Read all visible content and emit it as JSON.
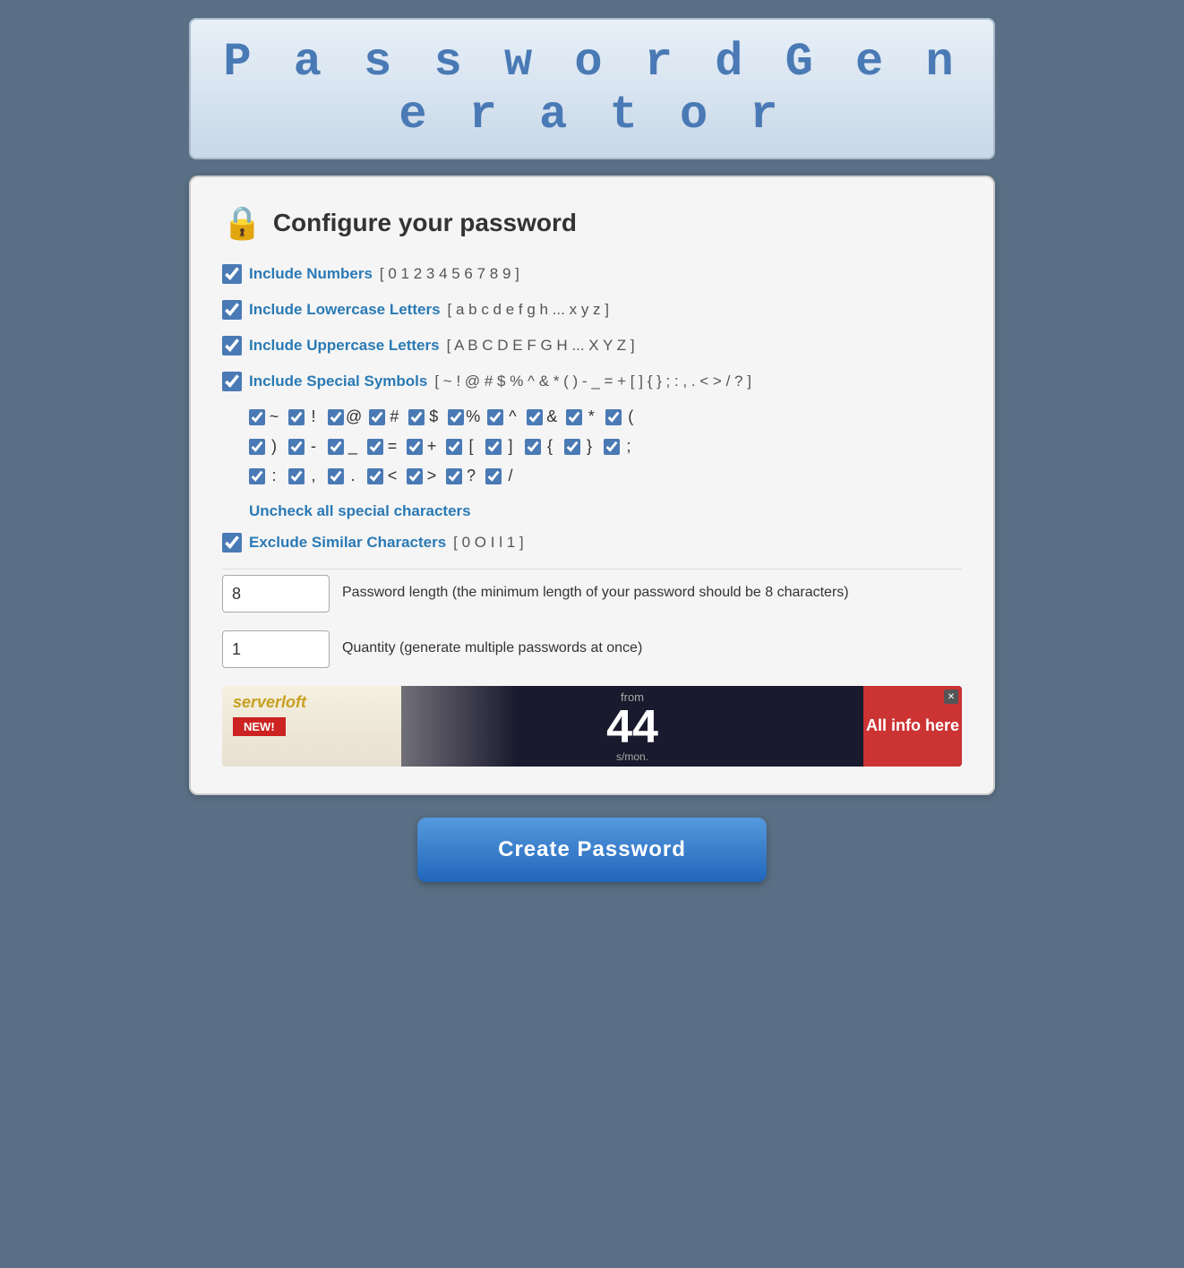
{
  "header": {
    "title": "P a s s w o r d   G e n e r a t o r"
  },
  "configure": {
    "title": "Configure your password",
    "lock_emoji": "🔒"
  },
  "options": {
    "numbers": {
      "label": "Include Numbers",
      "suffix": "[ 0 1 2 3 4 5 6 7 8 9 ]",
      "checked": true
    },
    "lowercase": {
      "label": "Include Lowercase Letters",
      "suffix": "[ a b c d e f g h ... x y z ]",
      "checked": true
    },
    "uppercase": {
      "label": "Include Uppercase Letters",
      "suffix": "[ A B C D E F G H ... X Y Z ]",
      "checked": true
    },
    "special": {
      "label": "Include Special Symbols",
      "suffix": "[ ~ ! @ # $ % ^ & * ( ) - _ = + [ ] { } ; : , . < > / ? ]",
      "checked": true
    }
  },
  "special_chars": {
    "row1": [
      "~",
      "!",
      "@",
      "#",
      "$",
      "%",
      "^",
      "&",
      "*",
      "("
    ],
    "row2": [
      ")",
      "-",
      "_",
      "=",
      "+",
      "[",
      "]",
      "{",
      "}",
      ";"
    ],
    "row3": [
      ":",
      ",",
      ".",
      "<",
      ">",
      "?",
      "/"
    ]
  },
  "uncheck_link": "Uncheck all special characters",
  "exclude_similar": {
    "label": "Exclude Similar Characters",
    "suffix": "[ 0 O I l 1 ]",
    "checked": true
  },
  "password_length": {
    "value": "8",
    "description": "Password length (the minimum length of your password should be 8 characters)"
  },
  "quantity": {
    "value": "1",
    "description": "Quantity (generate multiple passwords at once)"
  },
  "ad": {
    "brand": "serverloft",
    "new_label": "NEW!",
    "number": "44",
    "from_text": "from",
    "per_text": "s/mon.",
    "cta": "All info here"
  },
  "create_button": {
    "label": "Create Password"
  }
}
